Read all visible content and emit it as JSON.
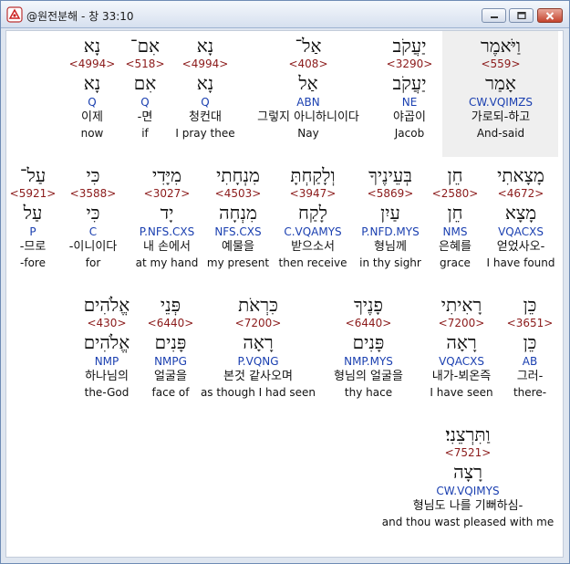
{
  "window": {
    "title": "@원전분해 - 창 33:10"
  },
  "rows": [
    [
      {
        "heb": "וַיֹּאמֶר",
        "strong": "<559>",
        "lemma": "אָמַר",
        "morph": "CW.VQIMZS",
        "kor": "가로되-하고",
        "eng": "And-said"
      },
      {
        "heb": "יַעֲקֹב",
        "strong": "<3290>",
        "lemma": "יַעֲקֹב",
        "morph": "NE",
        "kor": "야곱이",
        "eng": "Jacob"
      },
      {
        "heb": "אַל־",
        "strong": "<408>",
        "lemma": "אַל",
        "morph": "ABN",
        "kor": "그렇지 아니하니이다",
        "eng": "Nay"
      },
      {
        "heb": "נָא",
        "strong": "<4994>",
        "lemma": "נָא",
        "morph": "Q",
        "kor": "청컨대",
        "eng": "I pray thee"
      },
      {
        "heb": "אִם־",
        "strong": "<518>",
        "lemma": "אִם",
        "morph": "Q",
        "kor": "-면",
        "eng": "if"
      },
      {
        "heb": "נָא",
        "strong": "<4994>",
        "lemma": "נָא",
        "morph": "Q",
        "kor": "이제",
        "eng": "now"
      }
    ],
    [
      {
        "heb": "מָצָאתִי",
        "strong": "<4672>",
        "lemma": "מָצָא",
        "morph": "VQACXS",
        "kor": "얻었사오-",
        "eng": "I have found"
      },
      {
        "heb": "חֵן",
        "strong": "<2580>",
        "lemma": "חֵן",
        "morph": "NMS",
        "kor": "은혜를",
        "eng": "grace"
      },
      {
        "heb": "בְּעֵינֶיךָ",
        "strong": "<5869>",
        "lemma": "עַיִן",
        "morph": "P.NFD.MYS",
        "kor": "형님께",
        "eng": "in thy sighr"
      },
      {
        "heb": "וְלָקַחְתָּ",
        "strong": "<3947>",
        "lemma": "לָקַח",
        "morph": "C.VQAMYS",
        "kor": "받으소서",
        "eng": "then receive"
      },
      {
        "heb": "מִנְחָתִי",
        "strong": "<4503>",
        "lemma": "מִנְחָה",
        "morph": "NFS.CXS",
        "kor": "예물을",
        "eng": "my present"
      },
      {
        "heb": "מִיָּדִי",
        "strong": "<3027>",
        "lemma": "יָד",
        "morph": "P.NFS.CXS",
        "kor": "내 손에서",
        "eng": "at my hand"
      },
      {
        "heb": "כִּי",
        "strong": "<3588>",
        "lemma": "כִּי",
        "morph": "C",
        "kor": "-이니이다",
        "eng": "for"
      },
      {
        "heb": "עַל־",
        "strong": "<5921>",
        "lemma": "עַל",
        "morph": "P",
        "kor": "-므로",
        "eng": "-fore"
      }
    ],
    [
      {
        "heb": "כֵּן",
        "strong": "<3651>",
        "lemma": "כֵּן",
        "morph": "AB",
        "kor": "그러-",
        "eng": "there-"
      },
      {
        "heb": "רָאִיתִי",
        "strong": "<7200>",
        "lemma": "רָאָה",
        "morph": "VQACXS",
        "kor": "내가-뵈온즉",
        "eng": "I have seen"
      },
      {
        "heb": "פָנֶיךָ",
        "strong": "<6440>",
        "lemma": "פָּנִים",
        "morph": "NMP.MYS",
        "kor": "형님의 얼굴을",
        "eng": "thy hace"
      },
      {
        "heb": "כִּרְאֹת",
        "strong": "<7200>",
        "lemma": "רָאָה",
        "morph": "P.VQNG",
        "kor": "본것 같사오며",
        "eng": "as though I had seen"
      },
      {
        "heb": "פְּנֵי",
        "strong": "<6440>",
        "lemma": "פָּנִים",
        "morph": "NMPG",
        "kor": "얼굴을",
        "eng": "face of"
      },
      {
        "heb": "אֱלֹהִים",
        "strong": "<430>",
        "lemma": "אֱלֹהִים",
        "morph": "NMP",
        "kor": "하나님의",
        "eng": "the-God"
      }
    ],
    [
      {
        "heb": "וַתִּרְצֵנִי׃",
        "strong": "<7521>",
        "lemma": "רָצָה",
        "morph": "CW.VQIMYS",
        "kor": "형님도 나를 기뻐하심-",
        "eng": "and thou wast pleased with me"
      }
    ]
  ]
}
